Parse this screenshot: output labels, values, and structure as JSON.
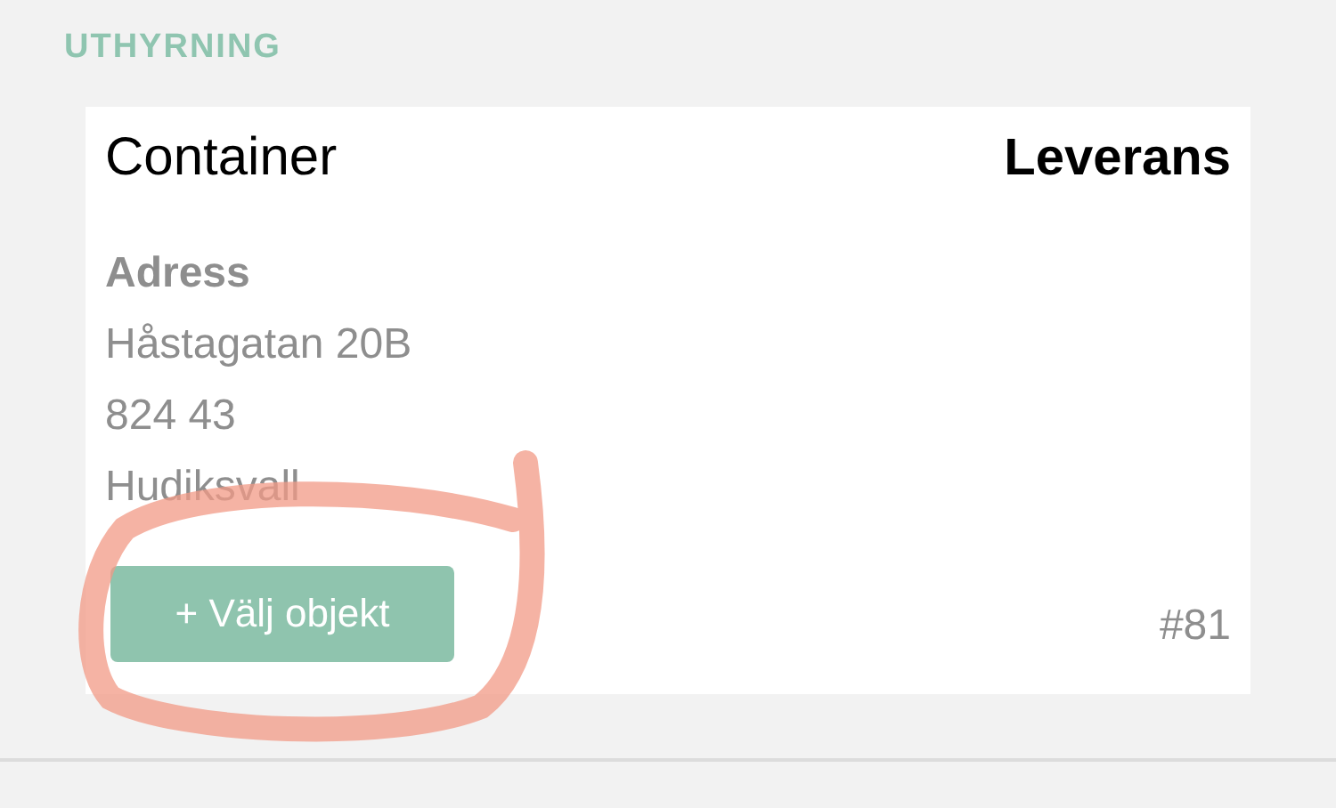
{
  "section_title": "UTHYRNING",
  "card": {
    "title": "Container",
    "type_label": "Leverans",
    "address_label": "Adress",
    "address_lines": [
      "Håstagatan 20B",
      "824 43",
      "Hudiksvall"
    ],
    "button": "+ Välj objekt",
    "number": "#81"
  }
}
